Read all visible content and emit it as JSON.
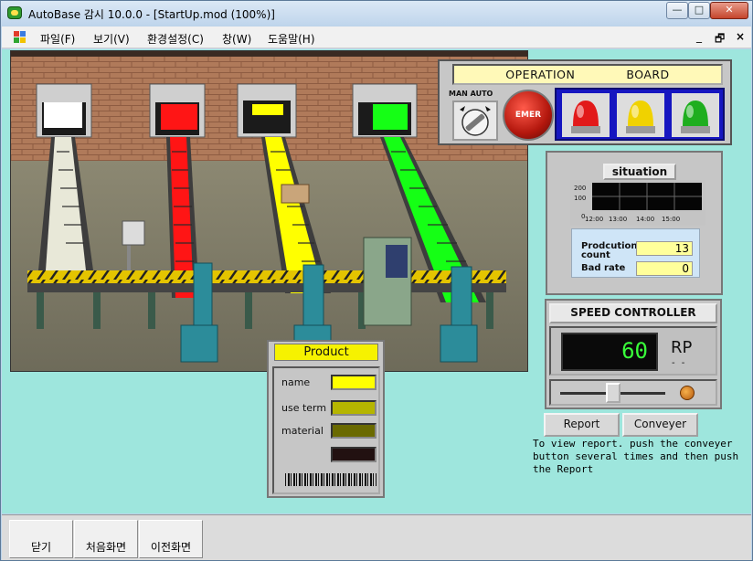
{
  "window": {
    "title": "AutoBase 감시 10.0.0 - [StartUp.mod (100%)]",
    "min_label": "—",
    "max_label": "□",
    "close_label": "✕"
  },
  "menubar": {
    "items": [
      "파일(F)",
      "보기(V)",
      "환경설정(C)",
      "창(W)",
      "도움말(H)"
    ],
    "mdi": {
      "minimize": "_",
      "restore": "🗗",
      "close": "×"
    }
  },
  "factory": {
    "lane_colors": [
      "#ffffff",
      "#ff1515",
      "#ffff00",
      "#15ff15"
    ]
  },
  "operation_board": {
    "title_left": "OPERATION",
    "title_right": "BOARD",
    "man": "MAN",
    "auto": "AUTO",
    "emer_label": "EMER",
    "lamps": [
      {
        "name": "red",
        "color": "#e21a1a"
      },
      {
        "name": "yellow",
        "color": "#f0d200"
      },
      {
        "name": "green",
        "color": "#1fae1f"
      }
    ]
  },
  "situation": {
    "title": "situation",
    "chart": {
      "y_ticks": [
        "200",
        "100",
        "0"
      ],
      "x_ticks": [
        "12:00",
        "13:00",
        "14:00",
        "15:00"
      ]
    },
    "production_count_label": "Prodcution count",
    "production_count": "13",
    "bad_rate_label": "Bad rate",
    "bad_rate": "0"
  },
  "speed_controller": {
    "title": "SPEED CONTROLLER",
    "value": "60",
    "unit": "RP",
    "unit_sub": "- -",
    "slider_fraction": 0.5
  },
  "buttons": {
    "report": "Report",
    "conveyer": "Conveyer"
  },
  "report_note": "To view report. push the conveyer\nbutton several times and then push\nthe Report",
  "product": {
    "title": "Product",
    "name_label": "name",
    "use_term_label": "use term",
    "material_label": "material",
    "swatches": [
      "#ffff00",
      "#b5b500",
      "#6a6a00",
      "#221111"
    ]
  },
  "bottom_nav": {
    "close": "닫기",
    "home": "처음화면",
    "previous": "이전화면"
  }
}
